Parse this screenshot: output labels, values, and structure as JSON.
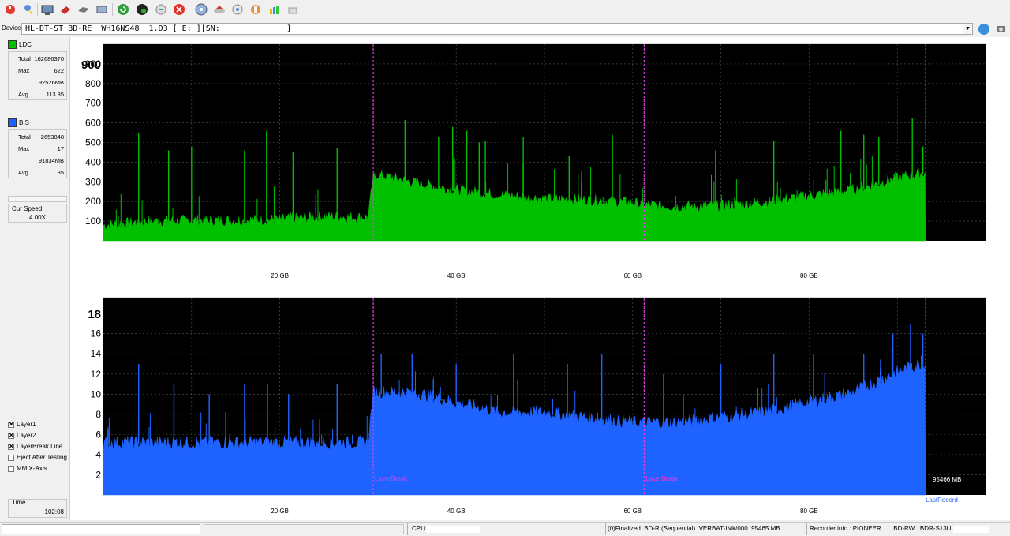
{
  "toolbar": {
    "buttons": [
      "power-icon",
      "pointer-icon",
      "monitor-icon",
      "eraser-icon",
      "disc-drive-icon",
      "export-icon",
      "refresh-icon",
      "globe-icon",
      "compare-icon",
      "stop-icon",
      "disc-icon",
      "eject-icon",
      "settings-icon",
      "save-icon",
      "chart-icon",
      "clear-icon"
    ]
  },
  "device": {
    "label": "Device:",
    "value": "HL-DT-ST BD-RE  WH16NS48  1.D3 [ E: ][SN:              ]"
  },
  "sidebar": {
    "ldc": {
      "label": "LDC",
      "color": "#00c000",
      "total_label": "Total",
      "total": "162686370",
      "max_label": "Max",
      "max": "622",
      "max_pos": "92526MB",
      "avg_label": "Avg",
      "avg": "113.35"
    },
    "bis": {
      "label": "BIS",
      "color": "#1e63ff",
      "total_label": "Total",
      "total": "2653848",
      "max_label": "Max",
      "max": "17",
      "max_pos": "91834MB",
      "avg_label": "Avg",
      "avg": "1.85"
    },
    "cur_speed_label": "Cur Speed",
    "cur_speed": "4.00X",
    "options": [
      {
        "label": "Layer1",
        "checked": true
      },
      {
        "label": "Layer2",
        "checked": true
      },
      {
        "label": "LayerBreak Line",
        "checked": true
      },
      {
        "label": "Eject After Testing",
        "checked": false
      },
      {
        "label": "MM X-Axis",
        "checked": false
      }
    ],
    "time_label": "Time",
    "time": "102:08"
  },
  "chart_data": [
    {
      "type": "area",
      "series": [
        {
          "name": "LDC",
          "color": "#00c000"
        }
      ],
      "x_unit": "GB",
      "x_ticks": [
        "20 GB",
        "40 GB",
        "60 GB",
        "80 GB"
      ],
      "x_tick_values": [
        20,
        40,
        60,
        80
      ],
      "xlim": [
        0,
        100
      ],
      "ylim": [
        0,
        1000
      ],
      "y_ticks": [
        100,
        200,
        300,
        400,
        500,
        600,
        700,
        800,
        900
      ],
      "y_top_label": "900",
      "profile": {
        "x": [
          0,
          5,
          10,
          15,
          20,
          25,
          30,
          30.6,
          31,
          35,
          40,
          45,
          50,
          55,
          60,
          61,
          65,
          70,
          75,
          80,
          85,
          90,
          93.2
        ],
        "y": [
          70,
          90,
          95,
          95,
          100,
          115,
          110,
          310,
          330,
          290,
          250,
          225,
          205,
          200,
          185,
          175,
          165,
          170,
          190,
          220,
          250,
          310,
          340
        ]
      },
      "spikes": {
        "x": [
          4,
          7.4,
          10,
          16,
          18.5,
          21.5,
          26.5,
          34.2,
          38,
          39.6,
          41.2,
          42.6,
          43.3,
          47.6,
          52.8,
          57.7,
          69.4,
          76,
          83.6,
          86.2,
          87.9,
          91.7,
          92.9
        ],
        "y": [
          550,
          460,
          480,
          460,
          560,
          450,
          470,
          615,
          530,
          580,
          560,
          500,
          510,
          530,
          430,
          540,
          460,
          510,
          560,
          540,
          530,
          625,
          480
        ]
      },
      "layer_breaks": [
        30.6,
        61.3
      ],
      "end_marker": 93.2
    },
    {
      "type": "area",
      "series": [
        {
          "name": "BIS",
          "color": "#1e63ff"
        }
      ],
      "x_unit": "GB",
      "x_ticks": [
        "20 GB",
        "40 GB",
        "60 GB",
        "80 GB"
      ],
      "x_tick_values": [
        20,
        40,
        60,
        80
      ],
      "xlim": [
        0,
        100
      ],
      "ylim": [
        0,
        19.5
      ],
      "y_ticks": [
        2,
        4,
        6,
        8,
        10,
        12,
        14,
        16
      ],
      "y_top_label": "18",
      "profile": {
        "x": [
          0,
          5,
          10,
          15,
          20,
          25,
          30,
          30.6,
          31,
          35,
          40,
          45,
          50,
          55,
          60,
          61,
          65,
          70,
          75,
          80,
          85,
          90,
          93.2
        ],
        "y": [
          5,
          5,
          5,
          5,
          5,
          5,
          5,
          10,
          10,
          10,
          9,
          8,
          8,
          7.5,
          7,
          7,
          7,
          7.5,
          8,
          9,
          10,
          12,
          13
        ]
      },
      "spikes": {
        "x": [
          4,
          8,
          12,
          16,
          18.6,
          21,
          26.5,
          31.5,
          35,
          40,
          46.5,
          52.6,
          56.5,
          63.5,
          70,
          76,
          80.5,
          86.2,
          89.5,
          91.5,
          92.9
        ],
        "y": [
          13,
          11,
          10,
          11,
          11,
          10,
          11,
          14,
          14,
          13,
          14,
          13,
          14,
          12,
          13,
          14,
          14,
          14,
          16,
          17,
          16
        ]
      },
      "layer_breaks": [
        30.6,
        61.3
      ],
      "layer_break_label": "LayerBreak",
      "end_marker": 93.2,
      "end_value_label": "95466 MB",
      "end_record_label": "LastRecord"
    }
  ],
  "status": {
    "cpu_label": "CPU:",
    "disc_info": "(0)Finalized  BD-R (Sequential)  VERBAT-IMk/000  95465 MB",
    "recorder_info": "Recorder info : PIONEER       BD-RW   BDR-S13U"
  }
}
